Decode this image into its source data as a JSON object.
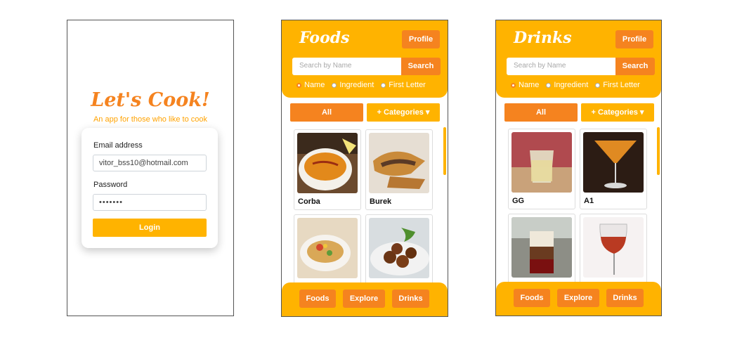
{
  "login": {
    "title": "Let's Cook!",
    "subtitle": "An app for those who like to cook",
    "email_label": "Email address",
    "email_value": "vitor_bss10@hotmail.com",
    "password_label": "Password",
    "password_value": "•••••••",
    "login_button": "Login"
  },
  "foods": {
    "title": "Foods",
    "profile": "Profile",
    "search_placeholder": "Search by Name",
    "search_button": "Search",
    "radio_name": "Name",
    "radio_ingredient": "Ingredient",
    "radio_first_letter": "First Letter",
    "filter_all": "All",
    "filter_categories": "+ Categories ▾",
    "cards": [
      {
        "name": "Corba"
      },
      {
        "name": "Burek"
      },
      {
        "name": ""
      },
      {
        "name": ""
      }
    ],
    "nav_foods": "Foods",
    "nav_explore": "Explore",
    "nav_drinks": "Drinks"
  },
  "drinks": {
    "title": "Drinks",
    "profile": "Profile",
    "search_placeholder": "Search by Name",
    "search_button": "Search",
    "radio_name": "Name",
    "radio_ingredient": "Ingredient",
    "radio_first_letter": "First Letter",
    "filter_all": "All",
    "filter_categories": "+ Categories ▾",
    "cards": [
      {
        "name": "GG"
      },
      {
        "name": "A1"
      },
      {
        "name": ""
      },
      {
        "name": ""
      }
    ],
    "nav_foods": "Foods",
    "nav_explore": "Explore",
    "nav_drinks": "Drinks"
  },
  "colors": {
    "primary": "#ffb300",
    "accent": "#f5831f"
  }
}
